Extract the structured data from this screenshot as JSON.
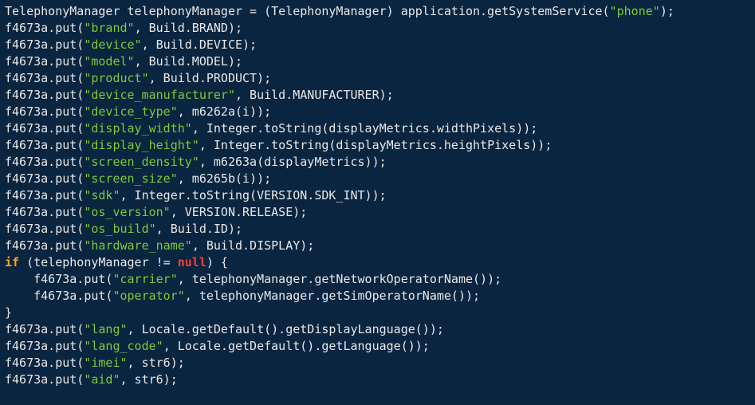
{
  "code": {
    "lines": [
      [
        {
          "t": "TelephonyManager telephonyManager = (TelephonyManager) application.getSystemService("
        },
        {
          "t": "\"phone\"",
          "c": "str"
        },
        {
          "t": ");"
        }
      ],
      [
        {
          "t": "f4673a.put("
        },
        {
          "t": "\"brand\"",
          "c": "str"
        },
        {
          "t": ", Build.BRAND);"
        }
      ],
      [
        {
          "t": "f4673a.put("
        },
        {
          "t": "\"device\"",
          "c": "str"
        },
        {
          "t": ", Build.DEVICE);"
        }
      ],
      [
        {
          "t": "f4673a.put("
        },
        {
          "t": "\"model\"",
          "c": "str"
        },
        {
          "t": ", Build.MODEL);"
        }
      ],
      [
        {
          "t": "f4673a.put("
        },
        {
          "t": "\"product\"",
          "c": "str"
        },
        {
          "t": ", Build.PRODUCT);"
        }
      ],
      [
        {
          "t": "f4673a.put("
        },
        {
          "t": "\"device_manufacturer\"",
          "c": "str"
        },
        {
          "t": ", Build.MANUFACTURER);"
        }
      ],
      [
        {
          "t": "f4673a.put("
        },
        {
          "t": "\"device_type\"",
          "c": "str"
        },
        {
          "t": ", m6262a(i));"
        }
      ],
      [
        {
          "t": "f4673a.put("
        },
        {
          "t": "\"display_width\"",
          "c": "str"
        },
        {
          "t": ", Integer.toString(displayMetrics.widthPixels));"
        }
      ],
      [
        {
          "t": "f4673a.put("
        },
        {
          "t": "\"display_height\"",
          "c": "str"
        },
        {
          "t": ", Integer.toString(displayMetrics.heightPixels));"
        }
      ],
      [
        {
          "t": "f4673a.put("
        },
        {
          "t": "\"screen_density\"",
          "c": "str"
        },
        {
          "t": ", m6263a(displayMetrics));"
        }
      ],
      [
        {
          "t": "f4673a.put("
        },
        {
          "t": "\"screen_size\"",
          "c": "str"
        },
        {
          "t": ", m6265b(i));"
        }
      ],
      [
        {
          "t": "f4673a.put("
        },
        {
          "t": "\"sdk\"",
          "c": "str"
        },
        {
          "t": ", Integer.toString(VERSION.SDK_INT));"
        }
      ],
      [
        {
          "t": "f4673a.put("
        },
        {
          "t": "\"os_version\"",
          "c": "str"
        },
        {
          "t": ", VERSION.RELEASE);"
        }
      ],
      [
        {
          "t": "f4673a.put("
        },
        {
          "t": "\"os_build\"",
          "c": "str"
        },
        {
          "t": ", Build.ID);"
        }
      ],
      [
        {
          "t": "f4673a.put("
        },
        {
          "t": "\"hardware_name\"",
          "c": "str"
        },
        {
          "t": ", Build.DISPLAY);"
        }
      ],
      [
        {
          "t": "if",
          "c": "kw"
        },
        {
          "t": " (telephonyManager != "
        },
        {
          "t": "null",
          "c": "null"
        },
        {
          "t": ") {"
        }
      ],
      [
        {
          "t": "    f4673a.put("
        },
        {
          "t": "\"carrier\"",
          "c": "str"
        },
        {
          "t": ", telephonyManager.getNetworkOperatorName());"
        }
      ],
      [
        {
          "t": "    f4673a.put("
        },
        {
          "t": "\"operator\"",
          "c": "str"
        },
        {
          "t": ", telephonyManager.getSimOperatorName());"
        }
      ],
      [
        {
          "t": "}"
        }
      ],
      [
        {
          "t": "f4673a.put("
        },
        {
          "t": "\"lang\"",
          "c": "str"
        },
        {
          "t": ", Locale.getDefault().getDisplayLanguage());"
        }
      ],
      [
        {
          "t": "f4673a.put("
        },
        {
          "t": "\"lang_code\"",
          "c": "str"
        },
        {
          "t": ", Locale.getDefault().getLanguage());"
        }
      ],
      [
        {
          "t": "f4673a.put("
        },
        {
          "t": "\"imei\"",
          "c": "str"
        },
        {
          "t": ", str6);"
        }
      ],
      [
        {
          "t": "f4673a.put("
        },
        {
          "t": "\"aid\"",
          "c": "str"
        },
        {
          "t": ", str6);"
        }
      ]
    ]
  }
}
